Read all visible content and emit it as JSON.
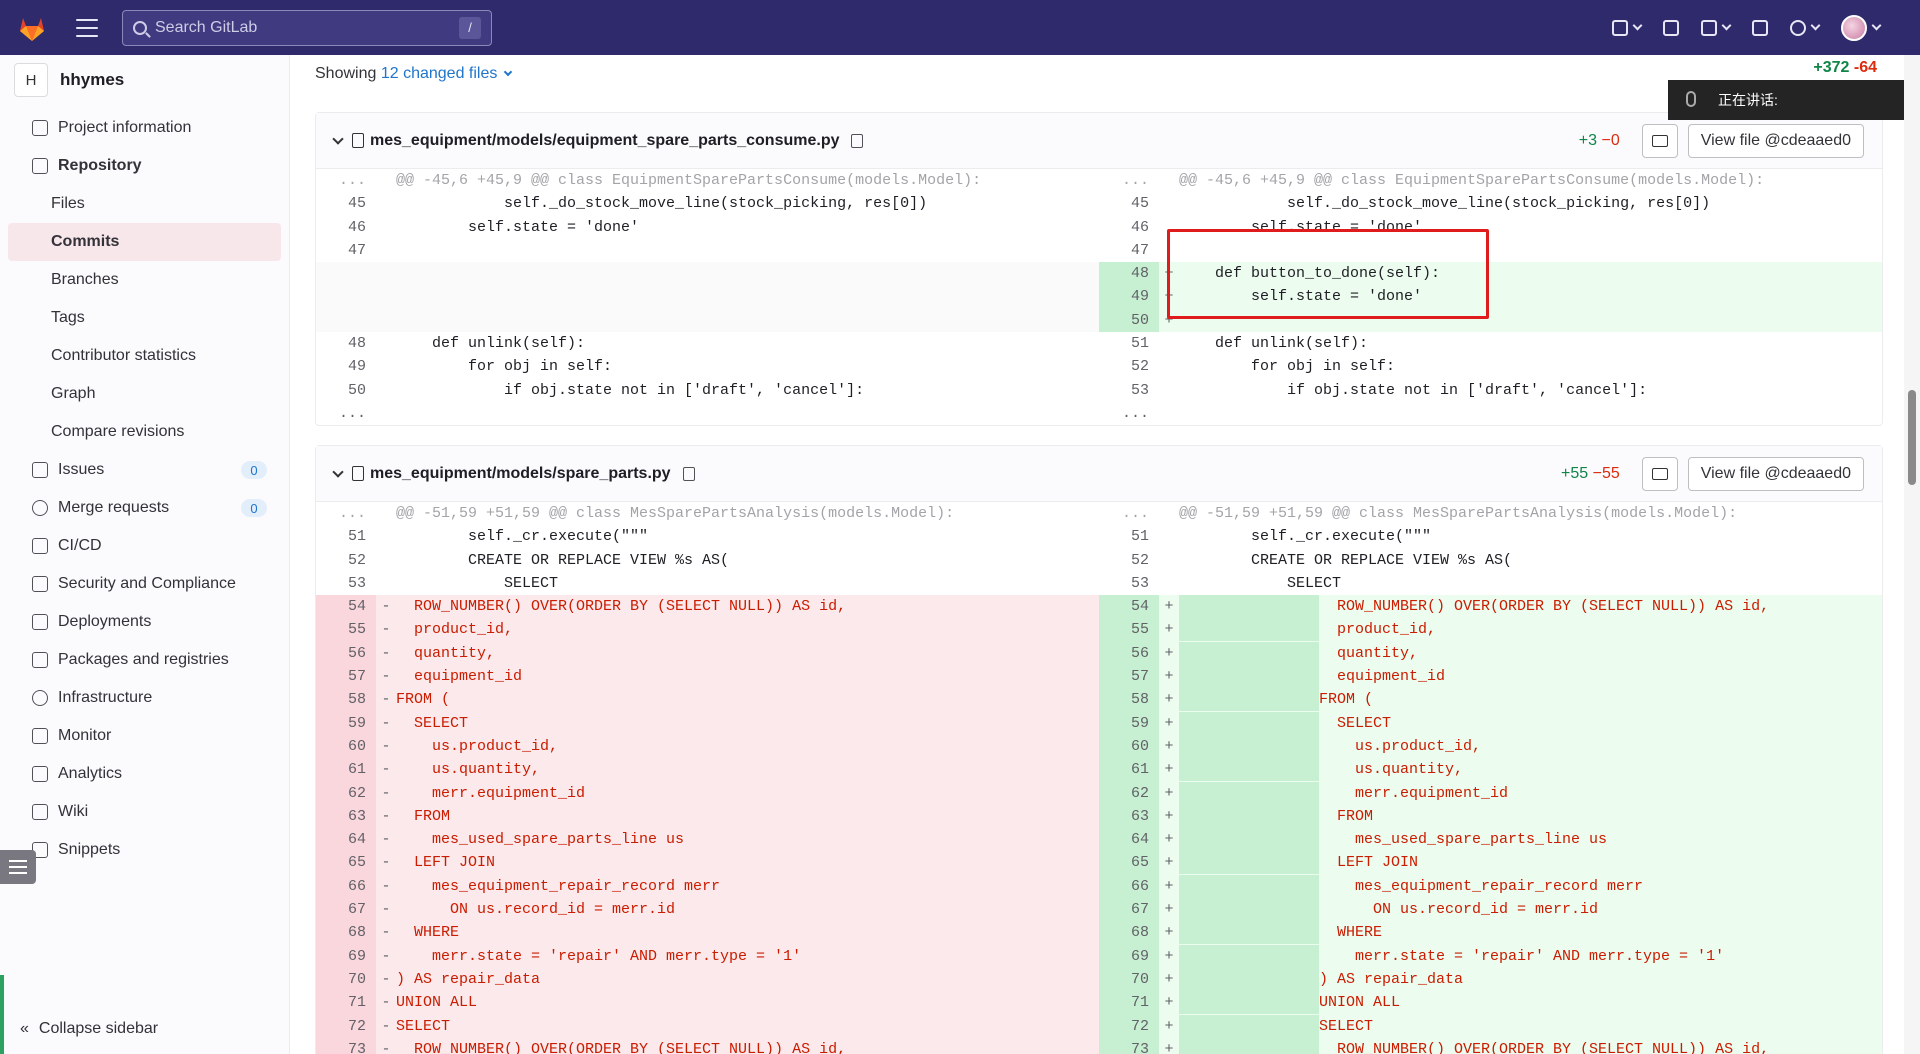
{
  "topbar": {
    "search_placeholder": "Search GitLab",
    "search_shortcut": "/"
  },
  "sidebar": {
    "project_initial": "H",
    "project_name": "hhymes",
    "items": [
      {
        "label": "Project information",
        "badge": ""
      },
      {
        "label": "Repository",
        "badge": ""
      },
      {
        "label": "Files",
        "badge": ""
      },
      {
        "label": "Commits",
        "badge": ""
      },
      {
        "label": "Branches",
        "badge": ""
      },
      {
        "label": "Tags",
        "badge": ""
      },
      {
        "label": "Contributor statistics",
        "badge": ""
      },
      {
        "label": "Graph",
        "badge": ""
      },
      {
        "label": "Compare revisions",
        "badge": ""
      },
      {
        "label": "Issues",
        "badge": "0"
      },
      {
        "label": "Merge requests",
        "badge": "0"
      },
      {
        "label": "CI/CD",
        "badge": ""
      },
      {
        "label": "Security and Compliance",
        "badge": ""
      },
      {
        "label": "Deployments",
        "badge": ""
      },
      {
        "label": "Packages and registries",
        "badge": ""
      },
      {
        "label": "Infrastructure",
        "badge": ""
      },
      {
        "label": "Monitor",
        "badge": ""
      },
      {
        "label": "Analytics",
        "badge": ""
      },
      {
        "label": "Wiki",
        "badge": ""
      },
      {
        "label": "Snippets",
        "badge": ""
      }
    ],
    "collapse_label": "Collapse sidebar"
  },
  "summary": {
    "showing_prefix": "Showing",
    "changed_files": "12 changed files",
    "additions": "+372",
    "deletions": "-64"
  },
  "voice_overlay": "正在讲话:",
  "files": [
    {
      "path": "mes_equipment/models/equipment_spare_parts_consume.py",
      "additions": "+3",
      "deletions": "−0",
      "view_label": "View file @cdeaaed0"
    },
    {
      "path": "mes_equipment/models/spare_parts.py",
      "additions": "+55",
      "deletions": "−55",
      "view_label": "View file @cdeaaed0"
    }
  ],
  "diff1": {
    "hunk": "@@ -45,6 +45,9 @@ class EquipmentSparePartsConsume(models.Model):",
    "ellipsis": "...",
    "rows": [
      {
        "l": "45",
        "lc": "            self._do_stock_move_line(stock_picking, res[0])",
        "r": "45",
        "rc": "            self._do_stock_move_line(stock_picking, res[0])",
        "t": "ctx"
      },
      {
        "l": "46",
        "lc": "        self.state = 'done'",
        "r": "46",
        "rc": "        self.state = 'done'",
        "t": "ctx"
      },
      {
        "l": "47",
        "lc": "",
        "r": "47",
        "rc": "",
        "t": "ctx"
      },
      {
        "l": "",
        "lc": "",
        "r": "48",
        "rc": "    def button_to_done(self):",
        "t": "add"
      },
      {
        "l": "",
        "lc": "",
        "r": "49",
        "rc": "        self.state = 'done'",
        "t": "add"
      },
      {
        "l": "",
        "lc": "",
        "r": "50",
        "rc": "",
        "t": "add"
      },
      {
        "l": "48",
        "lc": "    def unlink(self):",
        "r": "51",
        "rc": "    def unlink(self):",
        "t": "ctx"
      },
      {
        "l": "49",
        "lc": "        for obj in self:",
        "r": "52",
        "rc": "        for obj in self:",
        "t": "ctx"
      },
      {
        "l": "50",
        "lc": "            if obj.state not in ['draft', 'cancel']:",
        "r": "53",
        "rc": "            if obj.state not in ['draft', 'cancel']:",
        "t": "ctx"
      }
    ]
  },
  "diff2": {
    "hunk": "@@ -51,59 +51,59 @@ class MesSparePartsAnalysis(models.Model):",
    "rows": [
      {
        "l": "51",
        "lc": "        self._cr.execute(\"\"\"",
        "r": "51",
        "rc": "        self._cr.execute(\"\"\"",
        "t": "ctx"
      },
      {
        "l": "52",
        "lc": "        CREATE OR REPLACE VIEW %s AS(",
        "r": "52",
        "rc": "        CREATE OR REPLACE VIEW %s AS(",
        "t": "ctx"
      },
      {
        "l": "53",
        "lc": "            SELECT",
        "r": "53",
        "rc": "            SELECT",
        "t": "ctx"
      },
      {
        "l": "54",
        "lc": "  ROW_NUMBER() OVER(ORDER BY (SELECT NULL)) AS id,",
        "r": "54",
        "rc": "  ROW_NUMBER() OVER(ORDER BY (SELECT NULL)) AS id,",
        "t": "chg"
      },
      {
        "l": "55",
        "lc": "  product_id,",
        "r": "55",
        "rc": "  product_id,",
        "t": "chg"
      },
      {
        "l": "56",
        "lc": "  quantity,",
        "r": "56",
        "rc": "  quantity,",
        "t": "chg"
      },
      {
        "l": "57",
        "lc": "  equipment_id",
        "r": "57",
        "rc": "  equipment_id",
        "t": "chg"
      },
      {
        "l": "58",
        "lc": "FROM (",
        "r": "58",
        "rc": "FROM (",
        "t": "chg"
      },
      {
        "l": "59",
        "lc": "  SELECT",
        "r": "59",
        "rc": "  SELECT",
        "t": "chg"
      },
      {
        "l": "60",
        "lc": "    us.product_id,",
        "r": "60",
        "rc": "    us.product_id,",
        "t": "chg"
      },
      {
        "l": "61",
        "lc": "    us.quantity,",
        "r": "61",
        "rc": "    us.quantity,",
        "t": "chg"
      },
      {
        "l": "62",
        "lc": "    merr.equipment_id",
        "r": "62",
        "rc": "    merr.equipment_id",
        "t": "chg"
      },
      {
        "l": "63",
        "lc": "  FROM",
        "r": "63",
        "rc": "  FROM",
        "t": "chg"
      },
      {
        "l": "64",
        "lc": "    mes_used_spare_parts_line us",
        "r": "64",
        "rc": "    mes_used_spare_parts_line us",
        "t": "chg"
      },
      {
        "l": "65",
        "lc": "  LEFT JOIN",
        "r": "65",
        "rc": "  LEFT JOIN",
        "t": "chg"
      },
      {
        "l": "66",
        "lc": "    mes_equipment_repair_record merr",
        "r": "66",
        "rc": "    mes_equipment_repair_record merr",
        "t": "chg"
      },
      {
        "l": "67",
        "lc": "      ON us.record_id = merr.id",
        "r": "67",
        "rc": "      ON us.record_id = merr.id",
        "t": "chg"
      },
      {
        "l": "68",
        "lc": "  WHERE",
        "r": "68",
        "rc": "  WHERE",
        "t": "chg"
      },
      {
        "l": "69",
        "lc": "    merr.state = 'repair' AND merr.type = '1'",
        "r": "69",
        "rc": "    merr.state = 'repair' AND merr.type = '1'",
        "t": "chg"
      },
      {
        "l": "70",
        "lc": ") AS repair_data",
        "r": "70",
        "rc": ") AS repair_data",
        "t": "chg"
      },
      {
        "l": "71",
        "lc": "UNION ALL",
        "r": "71",
        "rc": "UNION ALL",
        "t": "chg"
      },
      {
        "l": "72",
        "lc": "SELECT",
        "r": "72",
        "rc": "SELECT",
        "t": "chg"
      },
      {
        "l": "73",
        "lc": "  ROW_NUMBER() OVER(ORDER BY (SELECT NULL)) AS id,",
        "r": "73",
        "rc": "  ROW_NUMBER() OVER(ORDER BY (SELECT NULL)) AS id,",
        "t": "chg"
      }
    ]
  }
}
